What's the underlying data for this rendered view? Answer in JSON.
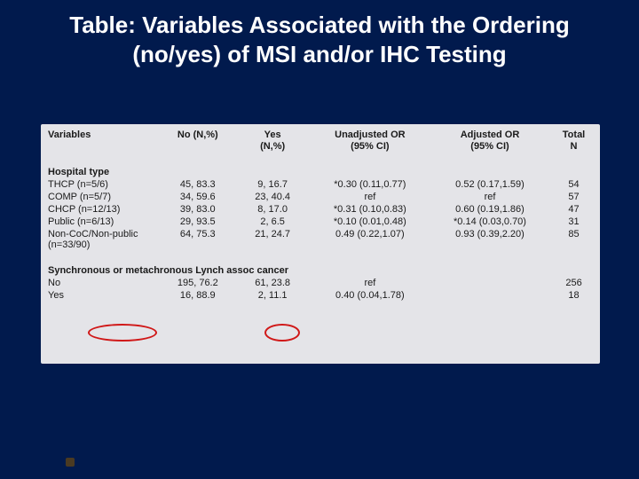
{
  "title": "Table: Variables Associated with the Ordering (no/yes) of MSI and/or IHC Testing",
  "headers": {
    "variables": "Variables",
    "no": "No (N,%)",
    "yes": "Yes\n(N,%)",
    "unadj": "Unadjusted OR\n(95% CI)",
    "adj": "Adjusted OR\n(95% CI)",
    "total": "Total\nN"
  },
  "section1": "Hospital type",
  "rows1": [
    {
      "v": "THCP (n=5/6)",
      "no": "45, 83.3",
      "yes": "9, 16.7",
      "un": "*0.30 (0.11,0.77)",
      "ad": "0.52 (0.17,1.59)",
      "t": "54"
    },
    {
      "v": "COMP (n=5/7)",
      "no": "34, 59.6",
      "yes": "23, 40.4",
      "un": "ref",
      "ad": "ref",
      "t": "57"
    },
    {
      "v": "CHCP (n=12/13)",
      "no": "39, 83.0",
      "yes": "8, 17.0",
      "un": "*0.31 (0.10,0.83)",
      "ad": "0.60 (0.19,1.86)",
      "t": "47"
    },
    {
      "v": "Public (n=6/13)",
      "no": "29, 93.5",
      "yes": "2, 6.5",
      "un": "*0.10 (0.01,0.48)",
      "ad": "*0.14 (0.03,0.70)",
      "t": "31"
    },
    {
      "v": "Non-CoC/Non-public (n=33/90)",
      "no": "64, 75.3",
      "yes": "21, 24.7",
      "un": "0.49 (0.22,1.07)",
      "ad": "0.93 (0.39,2.20)",
      "t": "85"
    }
  ],
  "section2": "Synchronous or metachronous Lynch assoc cancer",
  "rows2": [
    {
      "v": "No",
      "no": "195, 76.2",
      "yes": "61, 23.8",
      "un": "ref",
      "ad": "",
      "t": "256"
    },
    {
      "v": "Yes",
      "no": "16, 88.9",
      "yes": "2, 11.1",
      "un": "0.40 (0.04,1.78)",
      "ad": "",
      "t": "18"
    }
  ],
  "chart_data": {
    "type": "table",
    "title": "Variables Associated with the Ordering (no/yes) of MSI and/or IHC Testing",
    "columns": [
      "Variables",
      "No (N,%)",
      "Yes (N,%)",
      "Unadjusted OR (95% CI)",
      "Adjusted OR (95% CI)",
      "Total N"
    ],
    "sections": [
      {
        "name": "Hospital type",
        "rows": [
          [
            "THCP (n=5/6)",
            "45, 83.3",
            "9, 16.7",
            "*0.30 (0.11,0.77)",
            "0.52 (0.17,1.59)",
            54
          ],
          [
            "COMP (n=5/7)",
            "34, 59.6",
            "23, 40.4",
            "ref",
            "ref",
            57
          ],
          [
            "CHCP (n=12/13)",
            "39, 83.0",
            "8, 17.0",
            "*0.31 (0.10,0.83)",
            "0.60 (0.19,1.86)",
            47
          ],
          [
            "Public (n=6/13)",
            "29, 93.5",
            "2, 6.5",
            "*0.10 (0.01,0.48)",
            "*0.14 (0.03,0.70)",
            31
          ],
          [
            "Non-CoC/Non-public (n=33/90)",
            "64, 75.3",
            "21, 24.7",
            "0.49 (0.22,1.07)",
            "0.93 (0.39,2.20)",
            85
          ]
        ]
      },
      {
        "name": "Synchronous or metachronous Lynch assoc cancer",
        "rows": [
          [
            "No",
            "195, 76.2",
            "61, 23.8",
            "ref",
            "",
            256
          ],
          [
            "Yes",
            "16, 88.9",
            "2, 11.1",
            "0.40 (0.04,1.78)",
            "",
            18
          ]
        ]
      }
    ],
    "highlighted_cells": [
      "Public (n=6/13)",
      "2, 6.5"
    ]
  }
}
